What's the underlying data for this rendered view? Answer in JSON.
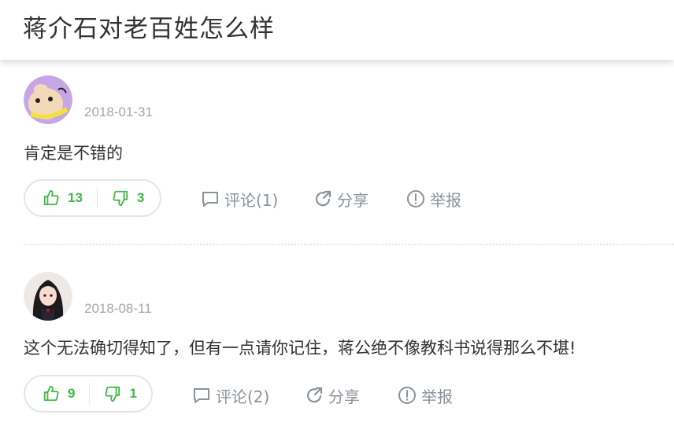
{
  "page": {
    "title": "蒋介石对老百姓怎么样"
  },
  "answers": [
    {
      "username": "██████ ████",
      "date": "2018-01-31",
      "content": "肯定是不错的",
      "upvotes": "13",
      "downvotes": "3",
      "comment_label": "评论(1)",
      "share_label": "分享",
      "report_label": "举报"
    },
    {
      "username": "██████",
      "date": "2018-08-11",
      "content": "这个无法确切得知了，但有一点请你记住，蒋公绝不像教科书说得那么不堪!",
      "upvotes": "9",
      "downvotes": "1",
      "comment_label": "评论(2)",
      "share_label": "分享",
      "report_label": "举报"
    }
  ],
  "colors": {
    "accent_green": "#43b649",
    "meta_gray": "#8a929a",
    "date_gray": "#a3a8ad"
  },
  "icons": [
    "thumbs-up-icon",
    "thumbs-down-icon",
    "comment-icon",
    "share-icon",
    "report-icon"
  ]
}
